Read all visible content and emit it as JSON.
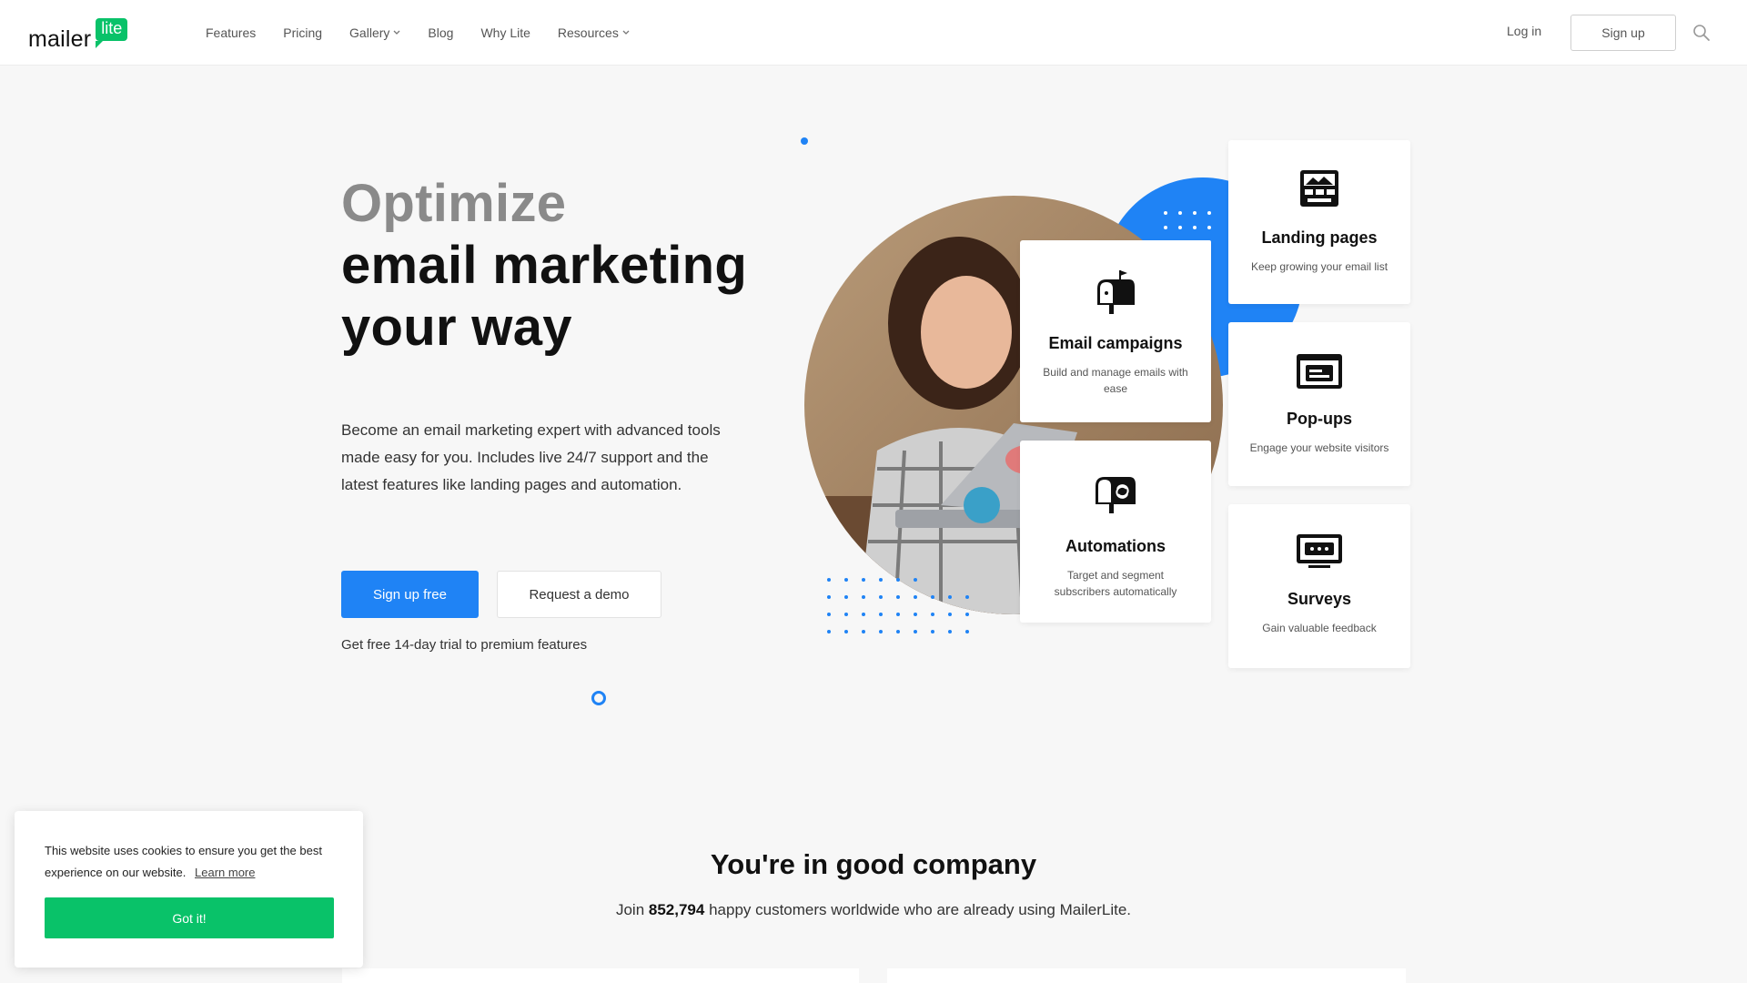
{
  "nav": {
    "logo_text": "mailer",
    "logo_badge": "lite",
    "items": [
      {
        "label": "Features",
        "dropdown": false
      },
      {
        "label": "Pricing",
        "dropdown": false
      },
      {
        "label": "Gallery",
        "dropdown": true
      },
      {
        "label": "Blog",
        "dropdown": false
      },
      {
        "label": "Why Lite",
        "dropdown": false
      },
      {
        "label": "Resources",
        "dropdown": true
      }
    ],
    "login": "Log in",
    "signup": "Sign up",
    "search_icon": "search-icon"
  },
  "hero": {
    "title_line1": "Optimize",
    "title_line2": "email marketing",
    "title_line3": "your way",
    "description": "Become an email marketing expert with advanced tools made easy for you. Includes live 24/7 support and the latest features like landing pages and automation.",
    "cta_primary": "Sign up free",
    "cta_secondary": "Request a demo",
    "trial_note": "Get free 14-day trial to premium features"
  },
  "features": {
    "email_campaigns": {
      "title": "Email campaigns",
      "sub": "Build and manage emails with ease",
      "icon": "mailbox-icon"
    },
    "automations": {
      "title": "Automations",
      "sub": "Target and segment subscribers automatically",
      "icon": "automation-mailbox-icon"
    },
    "landing_pages": {
      "title": "Landing pages",
      "sub": "Keep growing your email list",
      "icon": "landing-page-icon"
    },
    "popups": {
      "title": "Pop-ups",
      "sub": "Engage your website visitors",
      "icon": "popup-window-icon"
    },
    "surveys": {
      "title": "Surveys",
      "sub": "Gain valuable feedback",
      "icon": "survey-icon"
    }
  },
  "company": {
    "title": "You're in good company",
    "sub_prefix": "Join",
    "count": "852,794",
    "sub_suffix": "happy customers worldwide who are already using MailerLite."
  },
  "cookie": {
    "text": "This website uses cookies to ensure you get the best experience on our website.",
    "link": "Learn more",
    "button": "Got it!"
  },
  "colors": {
    "accent_blue": "#1f83f5",
    "brand_green": "#09c269"
  }
}
